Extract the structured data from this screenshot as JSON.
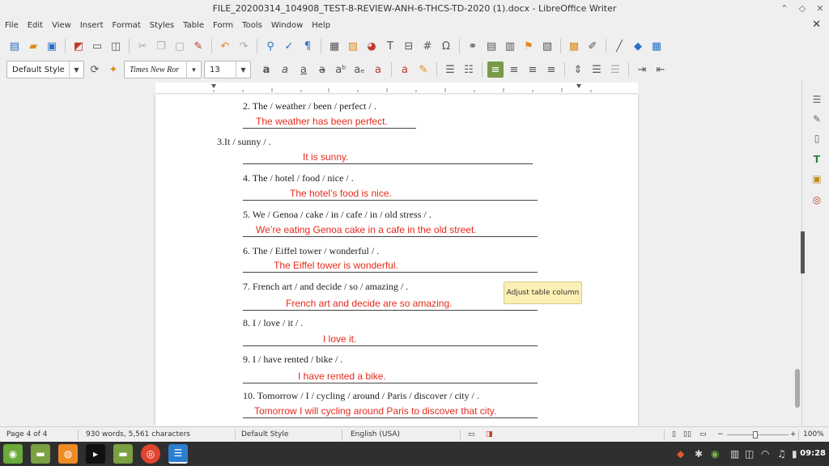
{
  "window": {
    "title": "FILE_20200314_104908_TEST-8-REVIEW-ANH-6-THCS-TD-2020 (1).docx - LibreOffice Writer",
    "minimize": "⌃",
    "maximize": "◇",
    "close": "✕"
  },
  "menu": {
    "items": [
      "File",
      "Edit",
      "View",
      "Insert",
      "Format",
      "Styles",
      "Table",
      "Form",
      "Tools",
      "Window",
      "Help"
    ],
    "close_doc": "✕"
  },
  "formatting": {
    "paragraph_style": "Default Style",
    "font_name": "Times New Ror",
    "font_size": "13"
  },
  "document": {
    "lines": [
      {
        "prompt": "2. The / weather / been / perfect / .",
        "answer": "The weather has been perfect."
      },
      {
        "prompt": "3.It / sunny / .",
        "answer": "It is sunny."
      },
      {
        "prompt": "4. The / hotel / food / nice / .",
        "answer": "The hotel’s food is nice."
      },
      {
        "prompt": "5. We / Genoa / cake / in / cafe / in / old stress / .",
        "answer": "We’re eating Genoa cake in a cafe in the old street."
      },
      {
        "prompt": "6. The / Eiffel tower / wonderful / .",
        "answer": "The Eiffel tower is wonderful."
      },
      {
        "prompt": "7. French art / and decide / so / amazing / .",
        "answer": "French art and decide are so amazing."
      },
      {
        "prompt": "8. I / love / it / .",
        "answer": "I love it."
      },
      {
        "prompt": "9. I / have rented / bike / .",
        "answer": "I have rented a bike."
      },
      {
        "prompt": "10. Tomorrow /  I / cycling / around / Paris / discover / city / .",
        "answer": "Tomorrow I will cycling around Paris to discover that city."
      }
    ]
  },
  "tooltip": "Adjust table column",
  "status": {
    "page": "Page 4 of 4",
    "words": "930 words, 5,561 characters",
    "style": "Default Style",
    "language": "English (USA)",
    "zoom": "100%"
  },
  "taskbar": {
    "clock": "09:28"
  },
  "colors": {
    "answer_text": "#e52a1c",
    "tooltip_bg": "#fbf0b4",
    "active_button": "#7a9a4a"
  }
}
